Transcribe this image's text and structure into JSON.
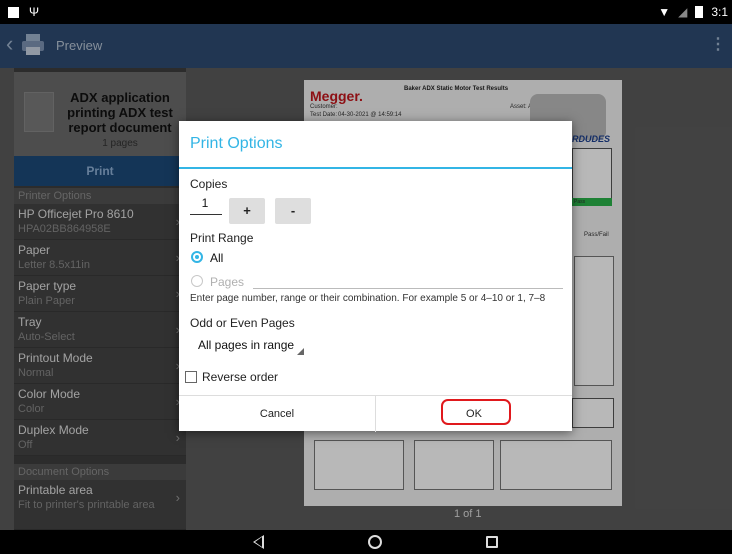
{
  "status_bar": {
    "time": "3:1"
  },
  "action_bar": {
    "title": "Preview"
  },
  "document": {
    "title": "ADX application printing ADX test report document",
    "pages": "1 pages"
  },
  "print_button": "Print",
  "printer_options": {
    "header": "Printer Options",
    "items": [
      {
        "label": "HP Officejet Pro 8610",
        "value": "HPA02BB864958E"
      },
      {
        "label": "Paper",
        "value": "Letter 8.5x11in"
      },
      {
        "label": "Paper type",
        "value": "Plain Paper"
      },
      {
        "label": "Tray",
        "value": "Auto-Select"
      },
      {
        "label": "Printout Mode",
        "value": "Normal"
      },
      {
        "label": "Color Mode",
        "value": "Color"
      },
      {
        "label": "Duplex Mode",
        "value": "Off"
      }
    ]
  },
  "document_options": {
    "header": "Document Options",
    "items": [
      {
        "label": "Printable area",
        "value": "Fit to printer's printable area"
      }
    ]
  },
  "preview": {
    "logo": "Megger.",
    "report_title": "Baker ADX Static Motor Test Results",
    "customer_label": "Customer:",
    "asset_label": "Asset: AC",
    "test_date_label": "Test Date:",
    "test_date_value": "04-30-2021 @ 14:59:14",
    "brand_tail": "RDUDES",
    "pass_label": "Pass",
    "passfail_header": "Pass/Fail",
    "page_indicator": "1 of 1"
  },
  "dialog": {
    "title": "Print Options",
    "copies_label": "Copies",
    "copies_value": "1",
    "plus_label": "+",
    "minus_label": "-",
    "print_range_label": "Print Range",
    "range_all": "All",
    "range_pages": "Pages",
    "range_hint": "Enter page number, range or their combination. For example 5 or 4–10 or 1, 7–8",
    "odd_even_label": "Odd or Even Pages",
    "odd_even_value": "All pages in range",
    "reverse_order": "Reverse order",
    "cancel": "Cancel",
    "ok": "OK"
  },
  "colors": {
    "accent": "#33b5e5",
    "action_bar": "#2e4c72",
    "highlight": "#e0191d"
  }
}
